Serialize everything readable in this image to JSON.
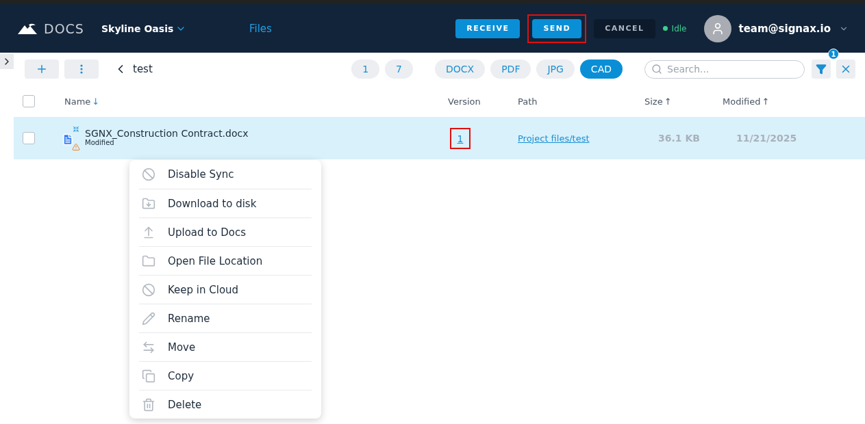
{
  "header": {
    "logo": "DOCS",
    "project": "Skyline Oasis",
    "nav": [
      {
        "label": "Files",
        "selected": true
      }
    ],
    "actions": [
      {
        "label": "RECEIVE",
        "kind": "primary",
        "highlighted": false
      },
      {
        "label": "SEND",
        "kind": "primary",
        "highlighted": true
      },
      {
        "label": "CANCEL",
        "kind": "dark",
        "highlighted": false
      }
    ],
    "status": {
      "label": "Idle",
      "color": "#3ecf8e"
    },
    "user": "team@signax.io"
  },
  "toolbar": {
    "breadcrumb": "test",
    "counts": [
      {
        "label": "1",
        "selected": false
      },
      {
        "label": "7",
        "selected": false
      }
    ],
    "filters": [
      {
        "label": "DOCX",
        "selected": false
      },
      {
        "label": "PDF",
        "selected": false
      },
      {
        "label": "JPG",
        "selected": false
      },
      {
        "label": "CAD",
        "selected": true
      }
    ],
    "search": {
      "placeholder": "Search..."
    },
    "filter_badge": "1"
  },
  "table": {
    "all_checked": false,
    "columns": [
      {
        "label": "Name",
        "sort_mark": "↓"
      },
      {
        "label": "Version"
      },
      {
        "label": "Path"
      },
      {
        "label": "Size",
        "sort_mark": "↑"
      },
      {
        "label": "Modified",
        "sort_mark": "↑"
      }
    ],
    "rows": [
      {
        "name": "SGNX_Construction Contract.docx",
        "status": "Modified",
        "version": "1",
        "version_highlighted": true,
        "path": "Project files/test",
        "size": "36.1 KB",
        "modified": "11/21/2025",
        "selected": true,
        "checked": false
      }
    ]
  },
  "context_menu": [
    {
      "label": "Disable Sync",
      "kind": "block"
    },
    {
      "label": "Download to disk",
      "kind": "download"
    },
    {
      "label": "Upload to Docs",
      "kind": "upload"
    },
    {
      "label": "Open File Location",
      "kind": "folder"
    },
    {
      "label": "Keep in Cloud",
      "kind": "block"
    },
    {
      "label": "Rename",
      "kind": "rename"
    },
    {
      "label": "Move",
      "kind": "move"
    },
    {
      "label": "Copy",
      "kind": "copy"
    },
    {
      "label": "Delete",
      "kind": "delete"
    }
  ]
}
